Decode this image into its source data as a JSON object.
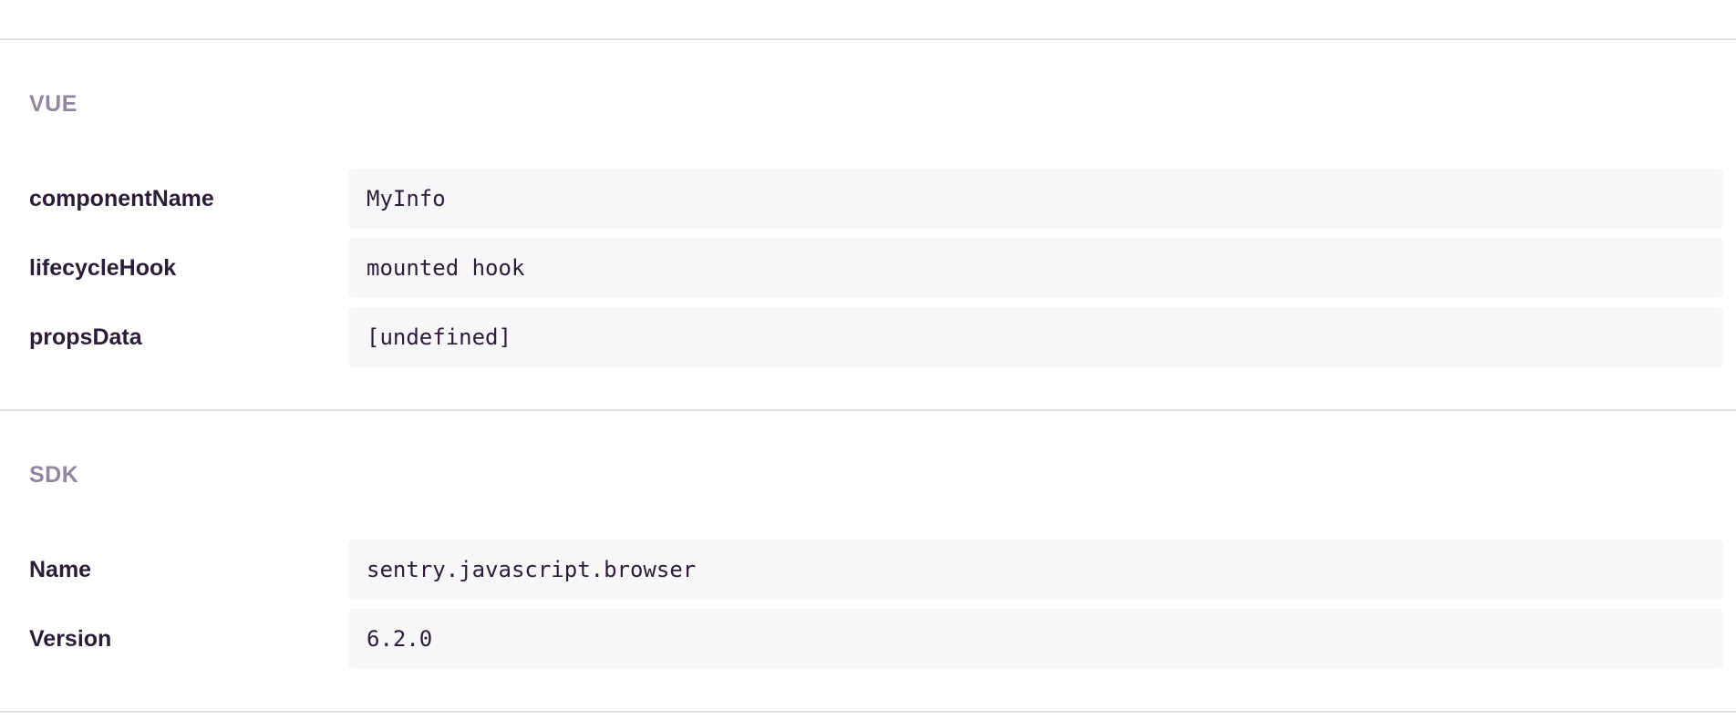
{
  "sections": [
    {
      "title": "VUE",
      "rows": [
        {
          "key": "componentName",
          "value": "MyInfo"
        },
        {
          "key": "lifecycleHook",
          "value": "mounted hook"
        },
        {
          "key": "propsData",
          "value": "[undefined]"
        }
      ]
    },
    {
      "title": "SDK",
      "rows": [
        {
          "key": "Name",
          "value": "sentry.javascript.browser"
        },
        {
          "key": "Version",
          "value": "6.2.0"
        }
      ]
    }
  ]
}
